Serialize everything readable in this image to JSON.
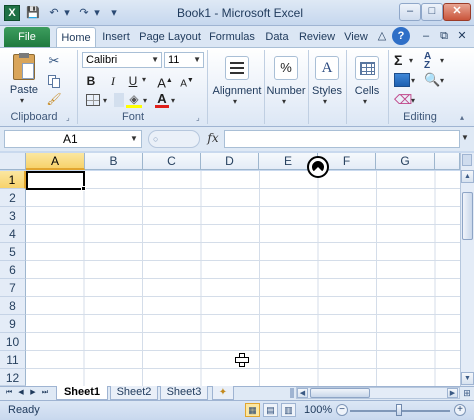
{
  "window": {
    "title": "Book1 - Microsoft Excel",
    "app_icon_letter": "X",
    "minimize": "–",
    "restore": "□",
    "close": "✕",
    "ribbon_min": "△",
    "help": "?",
    "doc_minimize": "–",
    "doc_restore": "⧉",
    "doc_close": "✕"
  },
  "quick_access": {
    "save": "💾",
    "undo": "↶",
    "redo": "↷",
    "customize": "▾"
  },
  "tabs": {
    "file": "File",
    "items": [
      "Home",
      "Insert",
      "Page Layout",
      "Formulas",
      "Data",
      "Review",
      "View"
    ]
  },
  "ribbon": {
    "clipboard": {
      "paste": "Paste",
      "label": "Clipboard"
    },
    "font": {
      "name": "Calibri",
      "size": "11",
      "bold": "B",
      "italic": "I",
      "underline": "U",
      "grow": "A",
      "shrink": "A",
      "label": "Font"
    },
    "alignment": {
      "label": "Alignment"
    },
    "number": {
      "icon": "%",
      "label": "Number"
    },
    "styles": {
      "icon": "A",
      "label": "Styles"
    },
    "cells": {
      "label": "Cells"
    },
    "editing": {
      "label": "Editing",
      "sum": "Σ"
    }
  },
  "formula_bar": {
    "name_box": "A1",
    "fx": "fx",
    "formula": ""
  },
  "grid": {
    "columns": [
      "A",
      "B",
      "C",
      "D",
      "E",
      "F",
      "G"
    ],
    "rows": [
      "1",
      "2",
      "3",
      "4",
      "5",
      "6",
      "7",
      "8",
      "9",
      "10",
      "11",
      "12"
    ],
    "active_cell": "A1"
  },
  "sheets": {
    "tabs": [
      "Sheet1",
      "Sheet2",
      "Sheet3"
    ],
    "active": "Sheet1"
  },
  "status": {
    "text": "Ready",
    "zoom": "100%",
    "zoom_level_percent": 100,
    "zoom_out": "−",
    "zoom_in": "+"
  },
  "colors": {
    "accent_green": "#1f7a3f",
    "ribbon_bg": "#dfe9f5",
    "selected_header": "#f7d26b"
  }
}
